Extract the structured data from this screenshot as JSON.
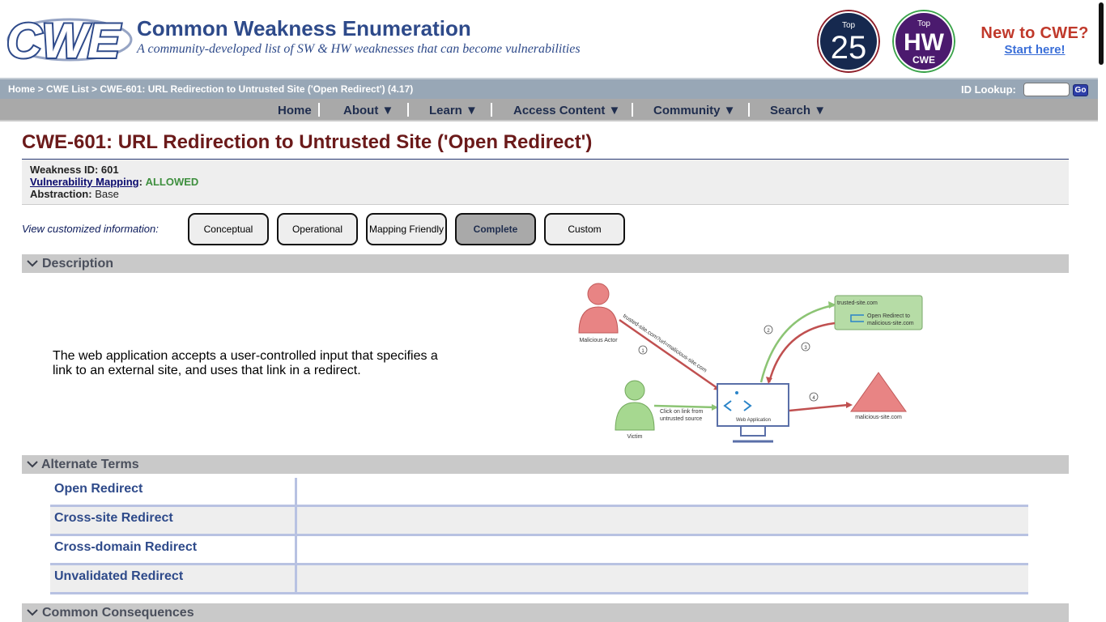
{
  "header": {
    "site_title": "Common Weakness Enumeration",
    "tagline": "A community-developed list of SW & HW weaknesses that can become vulnerabilities",
    "logo_text": "CWE",
    "badge_top25": {
      "small": "Top",
      "big": "25"
    },
    "badge_tophw": {
      "small": "Top",
      "big": "HW",
      "sub": "CWE"
    },
    "new_to_cwe": "New to CWE?",
    "start_here": "Start here!"
  },
  "breadcrumb": {
    "home": "Home",
    "sep1": " > ",
    "list": "CWE List",
    "sep2": " > ",
    "current": "CWE-601: URL Redirection to Untrusted Site ('Open Redirect') (4.17)"
  },
  "id_lookup": {
    "label": "ID Lookup:",
    "value": "",
    "go": "Go"
  },
  "nav": [
    "Home",
    "About ▼",
    "Learn ▼",
    "Access Content ▼",
    "Community ▼",
    "Search ▼"
  ],
  "page_title": "CWE-601: URL Redirection to Untrusted Site ('Open Redirect')",
  "id_box": {
    "weakness_id_label": "Weakness ID:",
    "weakness_id": "601",
    "mapping_label": "Vulnerability Mapping",
    "mapping_colon": ":",
    "mapping_value": "ALLOWED",
    "abstraction_label": "Abstraction:",
    "abstraction": "Base"
  },
  "views": {
    "label": "View customized information:",
    "buttons": [
      "Conceptual",
      "Operational",
      "Mapping Friendly",
      "Complete",
      "Custom"
    ],
    "active": "Complete"
  },
  "sections": {
    "description": "Description",
    "alternate_terms": "Alternate Terms",
    "common_consequences": "Common Consequences"
  },
  "description_text": "The web application accepts a user-controlled input that specifies a link to an external site, and uses that link in a redirect.",
  "diagram": {
    "malicious_actor": "Malicious Actor",
    "victim": "Victim",
    "url": "trusted-site.com?url=malicious-site.com",
    "click_link": "Click on link from",
    "untrusted_source": "untrusted source",
    "web_app": "Web Application",
    "trusted_site": "trusted-site.com",
    "open_redirect_1": "Open Redirect to",
    "open_redirect_2": "malicious-site.com",
    "malicious_site": "malicious-site.com",
    "step1": "1",
    "step2": "2",
    "step3": "3",
    "step4": "4"
  },
  "alternate_terms": [
    "Open Redirect",
    "Cross-site Redirect",
    "Cross-domain Redirect",
    "Unvalidated Redirect"
  ],
  "colors": {
    "brand_blue": "#2e4a8a",
    "title_red": "#6b1a1a",
    "allowed_green": "#3e8f3e",
    "crumb_bar": "#98a7b6",
    "nav_bar": "#a9a9a9"
  }
}
